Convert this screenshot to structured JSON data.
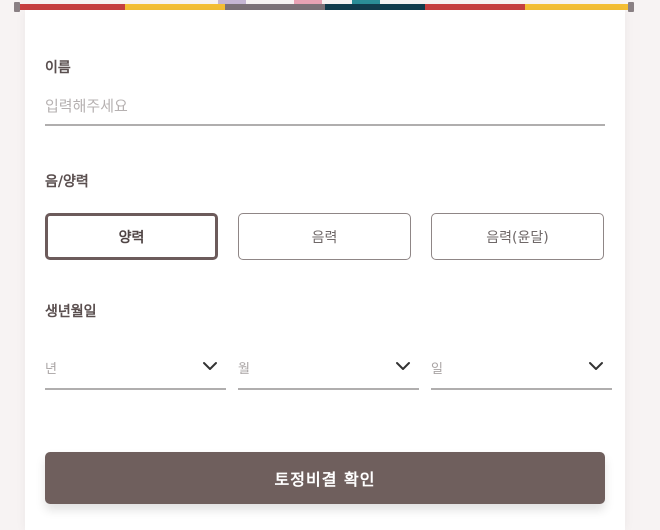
{
  "theme": {
    "primary": "#6f5f5d",
    "border": "#8f8686",
    "stripes": [
      "#c83f40",
      "#f5bf34",
      "#7d7279",
      "#123c4d",
      "#c83f40",
      "#f5bf34"
    ]
  },
  "form": {
    "name": {
      "label": "이름",
      "placeholder": "입력해주세요"
    },
    "calendar": {
      "label": "음/양력",
      "options": [
        "양력",
        "음력",
        "음력(윤달)"
      ],
      "selected": "양력"
    },
    "birthdate": {
      "label": "생년월일",
      "year_placeholder": "년",
      "month_placeholder": "월",
      "day_placeholder": "일",
      "chevron_icon": "chevron-down-icon"
    },
    "submit_label": "토정비결 확인"
  }
}
